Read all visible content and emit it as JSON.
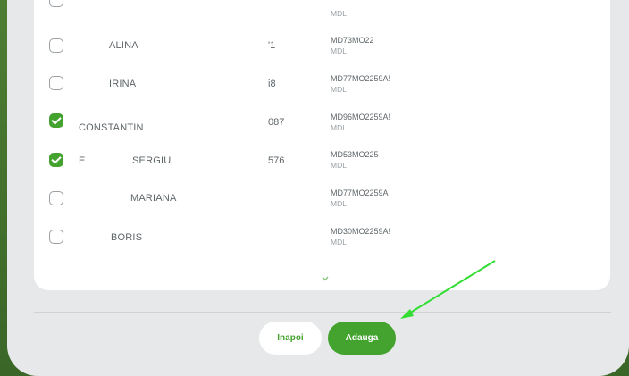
{
  "rows": [
    {
      "name": "ALINA",
      "prefix": "",
      "number": "'1",
      "account": "MD73MO22",
      "currency": "MDL",
      "checked": false
    },
    {
      "name": "IRINA",
      "prefix": "",
      "number": "i8",
      "account": "MD77MO2259A!",
      "currency": "MDL",
      "checked": false
    },
    {
      "name": "CONSTANTIN",
      "prefix": "",
      "number": "087",
      "account": "MD96MO2259A!",
      "currency": "MDL",
      "checked": true
    },
    {
      "name": "SERGIU",
      "prefix": "E",
      "number": "576",
      "account": "MD53MO225",
      "currency": "MDL",
      "checked": true
    },
    {
      "name": "MARIANA",
      "prefix": "",
      "number": "",
      "account": "MD77MO2259A",
      "currency": "MDL",
      "checked": false
    },
    {
      "name": "BORIS",
      "prefix": "",
      "number": "",
      "account": "MD30MO2259A!",
      "currency": "MDL",
      "checked": false
    }
  ],
  "top_partial_currency": "MDL",
  "scroll_indicator_icon": "chevron-down-icon",
  "buttons": {
    "back_label": "Inapoi",
    "add_label": "Adauga"
  },
  "colors": {
    "accent": "#44a32e",
    "arrow": "#33dd33"
  }
}
